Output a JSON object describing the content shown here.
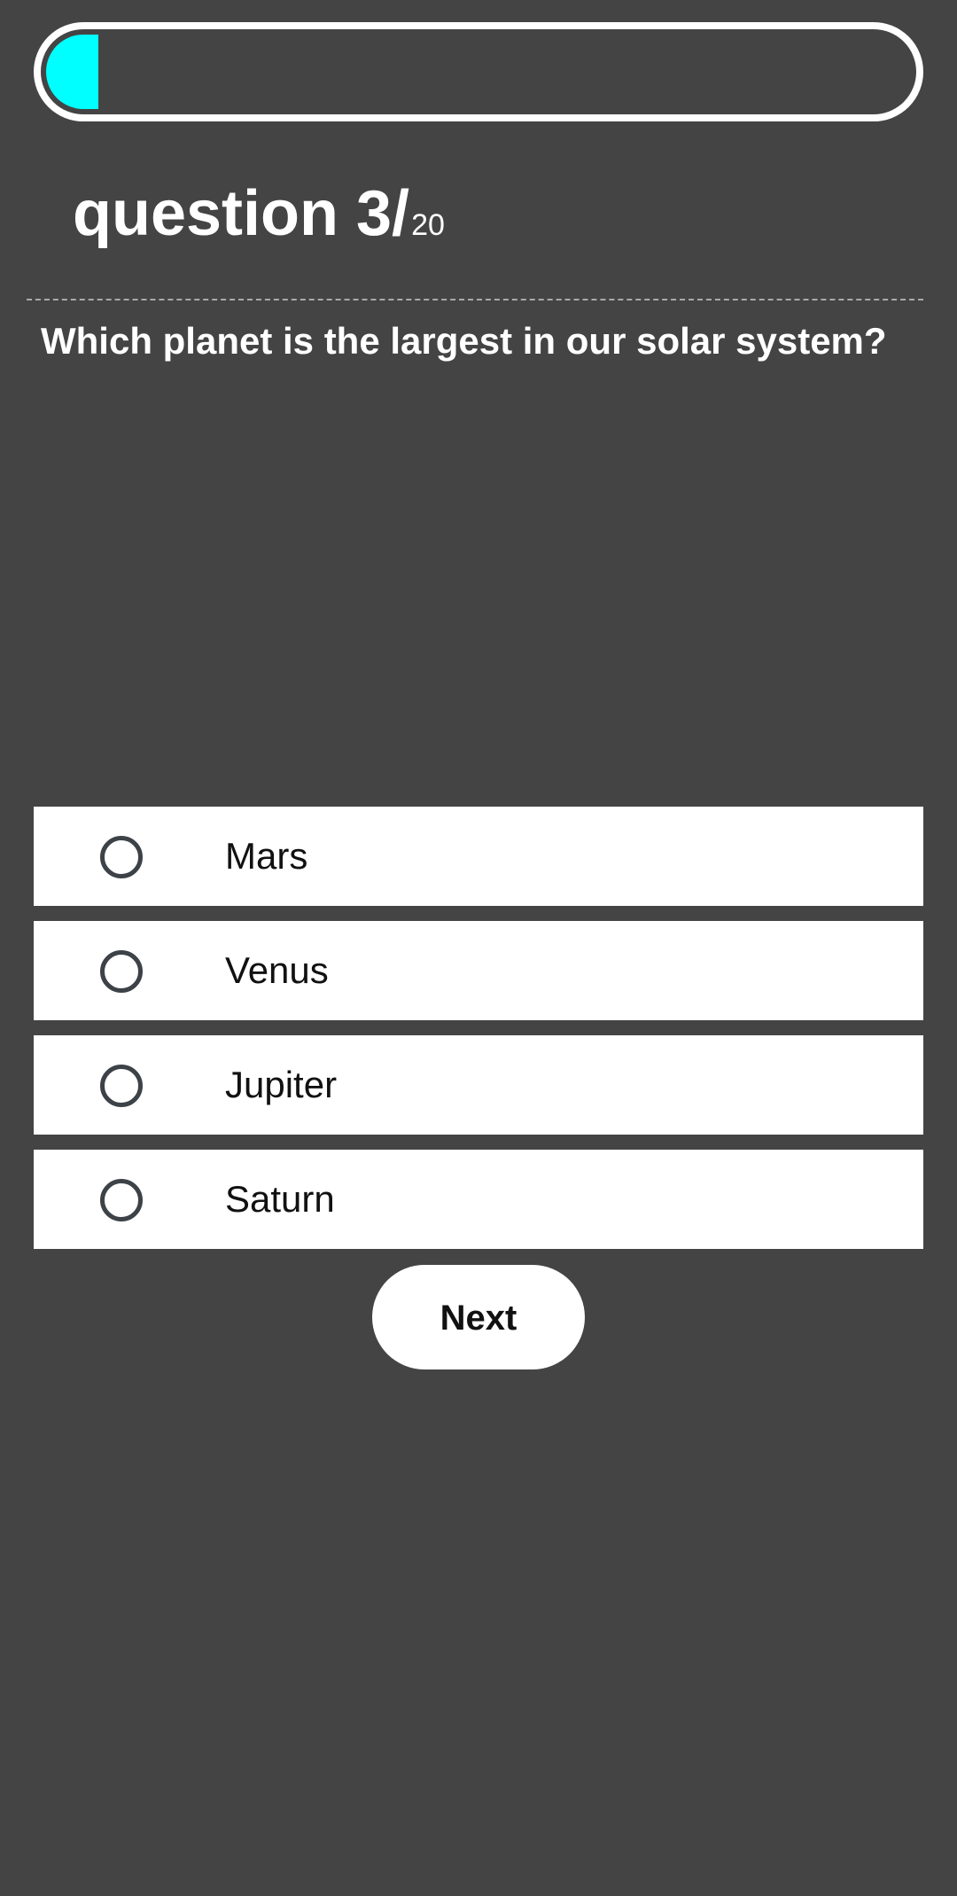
{
  "progress": {
    "current": 3,
    "total": 20,
    "fill_fraction": 0.06,
    "fill_color": "#00ffff"
  },
  "heading": {
    "word": "question",
    "current": "3",
    "slash": "/",
    "total": "20"
  },
  "question": {
    "text": "Which planet is the largest in our solar system?"
  },
  "options": [
    {
      "label": "Mars",
      "selected": false
    },
    {
      "label": "Venus",
      "selected": false
    },
    {
      "label": "Jupiter",
      "selected": false
    },
    {
      "label": "Saturn",
      "selected": false
    }
  ],
  "next_button": {
    "label": "Next"
  },
  "colors": {
    "background": "#444444",
    "accent": "#00ffff",
    "option_background": "#ffffff",
    "radio_border": "#3c4247"
  }
}
